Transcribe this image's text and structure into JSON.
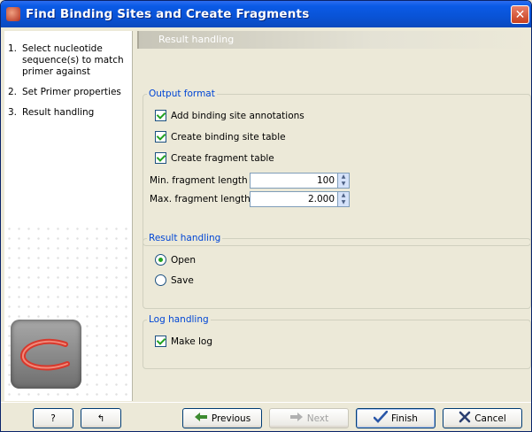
{
  "window": {
    "title": "Find Binding Sites and Create Fragments",
    "close_glyph": "✕"
  },
  "steps": [
    {
      "num": "1.",
      "label": "Select nucleotide sequence(s) to match primer against"
    },
    {
      "num": "2.",
      "label": "Set Primer properties"
    },
    {
      "num": "3.",
      "label": "Result handling"
    }
  ],
  "content": {
    "header": "Result handling",
    "output_format": {
      "legend": "Output format",
      "add_annotations": {
        "label": "Add binding site annotations",
        "checked": true
      },
      "binding_site_table": {
        "label": "Create binding site table",
        "checked": true
      },
      "fragment_table": {
        "label": "Create fragment table",
        "checked": true
      },
      "min_length": {
        "label": "Min. fragment length",
        "value": "100"
      },
      "max_length": {
        "label": "Max. fragment length",
        "value": "2.000"
      }
    },
    "result_handling": {
      "legend": "Result handling",
      "open": {
        "label": "Open",
        "selected": true
      },
      "save": {
        "label": "Save",
        "selected": false
      }
    },
    "log_handling": {
      "legend": "Log handling",
      "make_log": {
        "label": "Make log",
        "checked": true
      }
    }
  },
  "footer": {
    "help_label": "?",
    "reset_glyph": "↰",
    "previous_label": "Previous",
    "next_label": "Next",
    "finish_label": "Finish",
    "cancel_label": "Cancel"
  },
  "icons": {
    "app": "app-icon",
    "close": "close-icon",
    "spinner_up": "▲",
    "spinner_down": "▼",
    "previous": "arrow-left-icon",
    "next": "arrow-right-icon",
    "finish": "checkmark-icon",
    "cancel": "x-icon"
  },
  "colors": {
    "titlebar": "#0a5ae6",
    "legend": "#0046d5",
    "check": "#21a121",
    "dialog_bg": "#ece9d8"
  }
}
